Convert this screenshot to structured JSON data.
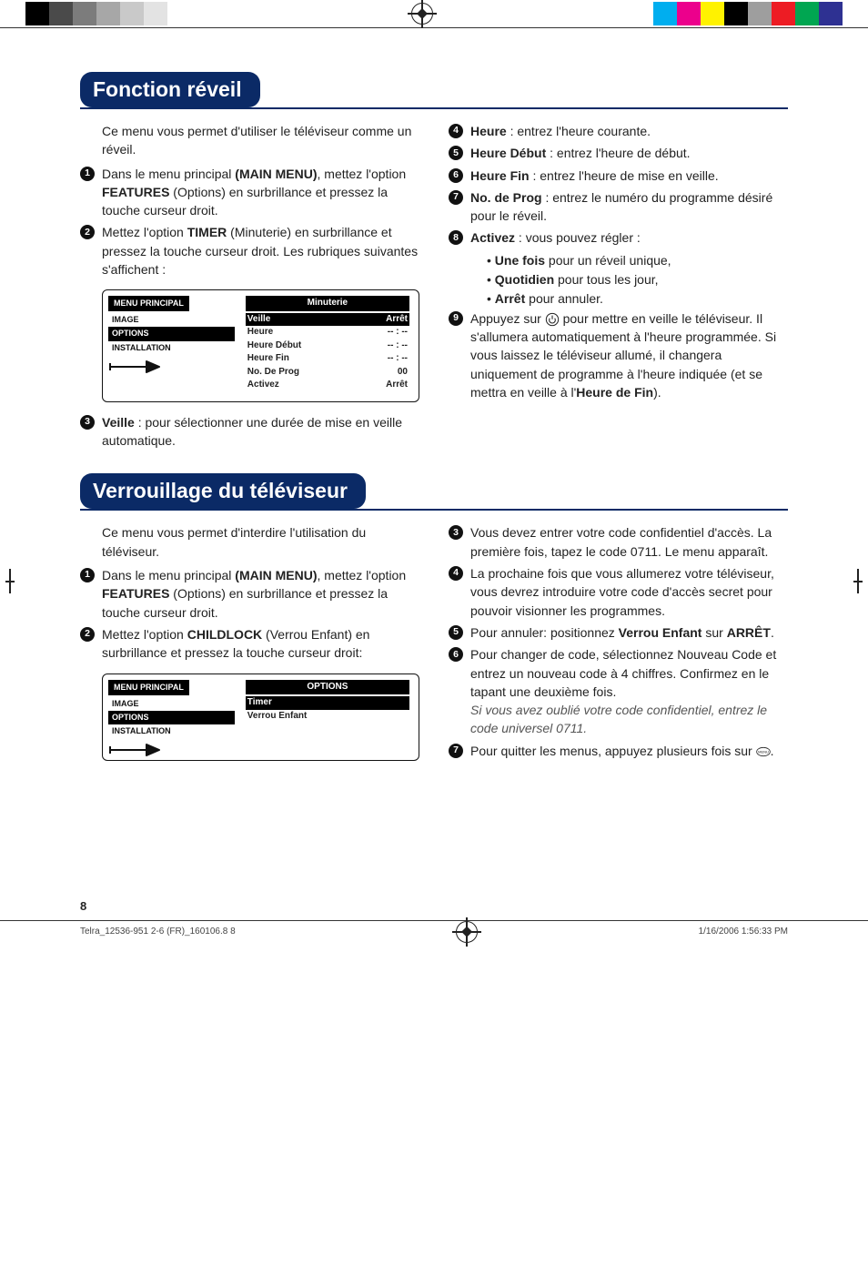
{
  "topbar": {
    "left_colors": [
      "#000000",
      "#4a4a4a",
      "#7c7c7c",
      "#a7a7a7",
      "#c9c9c9",
      "#e3e3e3",
      "#ffffff"
    ],
    "right_colors": [
      "#00aeef",
      "#ec008c",
      "#fff200",
      "#000000",
      "#9e9e9e",
      "#ed1c24",
      "#00a651",
      "#2e3192"
    ]
  },
  "section1": {
    "title": "Fonction réveil",
    "intro": "Ce menu vous permet d'utiliser le téléviseur comme un réveil.",
    "left_steps": [
      {
        "n": "1",
        "html": "Dans le menu principal <b>(MAIN MENU)</b>, mettez l'option <b>FEATURES</b> (Options) en surbrillance et pressez la touche curseur droit."
      },
      {
        "n": "2",
        "html": "Mettez l'option <b>TIMER</b> (Minuterie) en surbrillance et pressez la touche curseur droit. Les rubriques suivantes s'affichent :"
      }
    ],
    "after_osd_step": {
      "n": "3",
      "html": "<b>Veille</b> : pour sélectionner une durée de mise en veille automatique."
    },
    "right_steps": [
      {
        "n": "4",
        "html": "<b>Heure</b> : entrez l'heure courante."
      },
      {
        "n": "5",
        "html": "<b>Heure Début</b> : entrez l'heure de début."
      },
      {
        "n": "6",
        "html": "<b>Heure Fin</b> : entrez l'heure de mise en veille."
      },
      {
        "n": "7",
        "html": "<b>No. de Prog</b> : entrez le numéro du programme désiré pour le réveil."
      },
      {
        "n": "8",
        "html": "<b>Activez</b> : vous pouvez régler :"
      },
      {
        "n": "9",
        "html": "Appuyez sur <span class='small-icon'><svg viewBox='0 0 24 24'><circle cx='12' cy='12' r='10' fill='none' stroke='#222' stroke-width='1.5'/><path d='M12 6 v5' stroke='#222' stroke-width='1.6' stroke-linecap='round'/><path d='M8 10 a5 5 0 1 0 8 0' fill='none' stroke='#222' stroke-width='1.6'/></svg></span> pour mettre en veille le téléviseur. Il s'allumera automatiquement à l'heure programmée. Si vous laissez le téléviseur allumé, il changera uniquement de programme à l'heure indiquée (et se mettra en veille à l'<b>Heure de Fin</b>)."
      }
    ],
    "activez_points": [
      "<b>Une fois</b> pour un réveil unique,",
      "<b>Quotidien</b> pour tous les jour,",
      "<b>Arrêt</b> pour annuler."
    ],
    "osd": {
      "menu_label": "MENU PRINCIPAL",
      "menu_items": [
        "IMAGE",
        "OPTIONS",
        "INSTALLATION"
      ],
      "selected_menu": "OPTIONS",
      "panel_title": "Minuterie",
      "rows": [
        {
          "label": "Veille",
          "value": "Arrêt",
          "sel": true
        },
        {
          "label": "Heure",
          "value": "-- : --"
        },
        {
          "label": "Heure Début",
          "value": "-- : --"
        },
        {
          "label": "Heure Fin",
          "value": "-- : --"
        },
        {
          "label": "No. De Prog",
          "value": "00"
        },
        {
          "label": "Activez",
          "value": "Arrêt"
        }
      ]
    }
  },
  "section2": {
    "title": "Verrouillage du téléviseur",
    "intro": "Ce menu vous permet d'interdire l'utilisation du téléviseur.",
    "left_steps": [
      {
        "n": "1",
        "html": "Dans le menu principal <b>(MAIN MENU)</b>, mettez l'option <b>FEATURES</b> (Options) en surbrillance et pressez la touche curseur droit."
      },
      {
        "n": "2",
        "html": "Mettez l'option <b>CHILDLOCK</b> (Verrou Enfant) en surbrillance et pressez la touche curseur droit:"
      }
    ],
    "right_steps": [
      {
        "n": "3",
        "html": "Vous devez entrer votre code confidentiel d'accès. La première fois, tapez le code 0711. Le menu apparaît."
      },
      {
        "n": "4",
        "html": "La prochaine fois que vous allumerez votre téléviseur, vous devrez introduire votre code d'accès secret pour pouvoir visionner les programmes."
      },
      {
        "n": "5",
        "html": "Pour annuler: positionnez <b>Verrou Enfant</b> sur <b>ARRÊT</b>."
      },
      {
        "n": "6",
        "html": "Pour changer de code, sélectionnez Nouveau Code et entrez un nouveau code à 4 chiffres. Confirmez en le tapant une deuxième fois.<br><span class='italic'>Si vous avez oublié votre code confidentiel, entrez le code universel 0711.</span>"
      },
      {
        "n": "7",
        "html": "Pour quitter les menus, appuyez plusieurs fois sur <span class='small-icon'><svg viewBox='0 0 24 24'><ellipse cx='12' cy='12' rx='11' ry='7' fill='none' stroke='#222' stroke-width='1.2'/><text x='12' y='14' text-anchor='middle' font-size='6' fill='#222'>MENU</text></svg></span>."
      }
    ],
    "osd": {
      "menu_label": "MENU PRINCIPAL",
      "menu_items": [
        "IMAGE",
        "OPTIONS",
        "INSTALLATION"
      ],
      "selected_menu": "OPTIONS",
      "panel_title": "OPTIONS",
      "rows": [
        {
          "label": "Timer",
          "value": "",
          "sel": true
        },
        {
          "label": "Verrou Enfant",
          "value": ""
        }
      ]
    }
  },
  "page_number": "8",
  "footer": {
    "left": "Telra_12536-951 2-6 (FR)_160106.8   8",
    "right": "1/16/2006   1:56:33 PM"
  }
}
